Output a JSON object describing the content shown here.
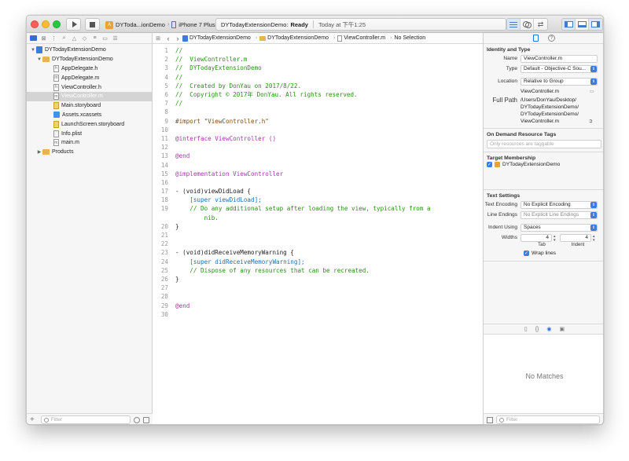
{
  "toolbar": {
    "scheme_name": "DYToda...ionDemo",
    "device_name": "iPhone 7 Plus",
    "activity_project": "DYTodayExtensionDemo:",
    "activity_status": "Ready",
    "activity_time": "Today at 下午1:25"
  },
  "navigator": {
    "items": [
      {
        "label": "DYTodayExtensionDemo",
        "kind": "project",
        "disclosure": "▼"
      },
      {
        "label": "DYTodayExtensionDemo",
        "kind": "folder",
        "disclosure": "▼"
      },
      {
        "label": "AppDelegate.h",
        "kind": "file",
        "badge": "h"
      },
      {
        "label": "AppDelegate.m",
        "kind": "file",
        "badge": "m"
      },
      {
        "label": "ViewController.h",
        "kind": "file",
        "badge": "h"
      },
      {
        "label": "ViewController.m",
        "kind": "file",
        "badge": "m",
        "selected": true
      },
      {
        "label": "Main.storyboard",
        "kind": "storyboard"
      },
      {
        "label": "Assets.xcassets",
        "kind": "assets"
      },
      {
        "label": "LaunchScreen.storyboard",
        "kind": "storyboard"
      },
      {
        "label": "Info.plist",
        "kind": "plist"
      },
      {
        "label": "main.m",
        "kind": "file",
        "badge": "m"
      },
      {
        "label": "Products",
        "kind": "folder",
        "disclosure": "▶"
      }
    ],
    "filter_placeholder": "Filter"
  },
  "jumpbar": {
    "project": "DYTodayExtensionDemo",
    "group": "DYTodayExtensionDemo",
    "file": "ViewController.m",
    "selection": "No Selection"
  },
  "code": {
    "lines": [
      {
        "n": "1",
        "t": "//"
      },
      {
        "n": "2",
        "t": "//  ViewController.m"
      },
      {
        "n": "3",
        "t": "//  DYTodayExtensionDemo"
      },
      {
        "n": "4",
        "t": "//"
      },
      {
        "n": "5",
        "t": "//  Created by DonYau on 2017/8/22."
      },
      {
        "n": "6",
        "t": "//  Copyright © 2017年 DonYau. All rights reserved."
      },
      {
        "n": "7",
        "t": "//"
      },
      {
        "n": "8",
        "t": ""
      },
      {
        "n": "9",
        "t": "#import \"ViewController.h\""
      },
      {
        "n": "10",
        "t": ""
      },
      {
        "n": "11",
        "t": "@interface ViewController ()"
      },
      {
        "n": "12",
        "t": ""
      },
      {
        "n": "13",
        "t": "@end"
      },
      {
        "n": "14",
        "t": ""
      },
      {
        "n": "15",
        "t": "@implementation ViewController"
      },
      {
        "n": "16",
        "t": ""
      },
      {
        "n": "17",
        "t": "- (void)viewDidLoad {"
      },
      {
        "n": "18",
        "t": "    [super viewDidLoad];"
      },
      {
        "n": "19",
        "t": "    // Do any additional setup after loading the view, typically from a"
      },
      {
        "n": "",
        "t": "        nib."
      },
      {
        "n": "20",
        "t": "}"
      },
      {
        "n": "21",
        "t": ""
      },
      {
        "n": "22",
        "t": ""
      },
      {
        "n": "23",
        "t": "- (void)didReceiveMemoryWarning {"
      },
      {
        "n": "24",
        "t": "    [super didReceiveMemoryWarning];"
      },
      {
        "n": "25",
        "t": "    // Dispose of any resources that can be recreated."
      },
      {
        "n": "26",
        "t": "}"
      },
      {
        "n": "27",
        "t": ""
      },
      {
        "n": "28",
        "t": ""
      },
      {
        "n": "29",
        "t": "@end"
      },
      {
        "n": "30",
        "t": ""
      }
    ]
  },
  "inspector": {
    "identity_title": "Identity and Type",
    "name_label": "Name",
    "name_value": "ViewController.m",
    "type_label": "Type",
    "type_value": "Default - Objective-C Sou...",
    "location_label": "Location",
    "location_value": "Relative to Group",
    "location_path": "ViewController.m",
    "fullpath_label": "Full Path",
    "fullpath_lines": [
      "/Users/DonYau/Desktop/",
      "DYTodayExtensionDemo/",
      "DYTodayExtensionDemo/",
      "ViewController.m"
    ],
    "odr_title": "On Demand Resource Tags",
    "odr_placeholder": "Only resources are taggable",
    "target_title": "Target Membership",
    "target_name": "DYTodayExtensionDemo",
    "text_title": "Text Settings",
    "encoding_label": "Text Encoding",
    "encoding_value": "No Explicit Encoding",
    "endings_label": "Line Endings",
    "endings_value": "No Explicit Line Endings",
    "indent_using_label": "Indent Using",
    "indent_using_value": "Spaces",
    "widths_label": "Widths",
    "tab_width": "4",
    "indent_width": "4",
    "tab_label": "Tab",
    "indent_label": "Indent",
    "wrap_label": "Wrap lines",
    "no_matches": "No Matches",
    "filter_placeholder": "Filter"
  }
}
